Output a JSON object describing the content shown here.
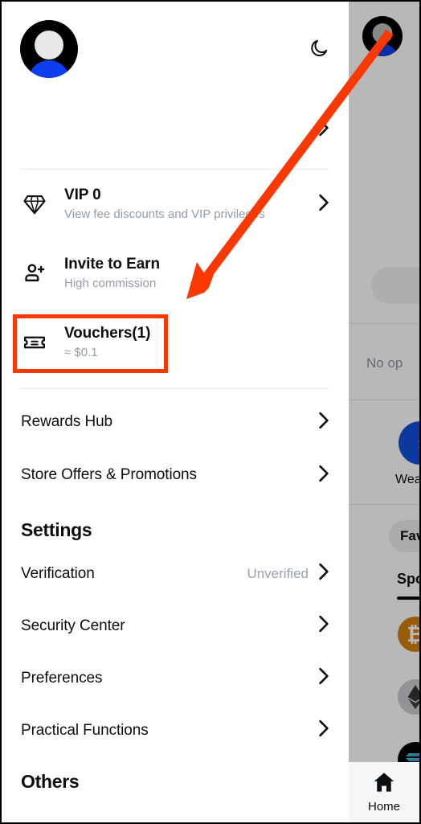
{
  "accent": {
    "highlight": "#f93802",
    "brand_blue": "#0d3ff0",
    "text": "#0b0e11",
    "muted": "#949ca8"
  },
  "drawer": {
    "header": {
      "avatar_icon": "user-avatar-icon",
      "theme_toggle_icon": "moon-icon"
    },
    "promo_row": {
      "chevron_icon": "chevron-right-icon"
    },
    "entries": [
      {
        "icon": "diamond-icon",
        "title": "VIP 0",
        "subtitle": "View fee discounts and VIP privileges",
        "chevron": "chevron-right-icon",
        "has_chevron": true
      },
      {
        "icon": "add-user-icon",
        "title": "Invite to Earn",
        "subtitle": "High commission",
        "chevron": "chevron-right-icon",
        "has_chevron": false
      },
      {
        "icon": "voucher-ticket-icon",
        "title": "Vouchers(1)",
        "subtitle": "≈ $0.1",
        "chevron": "chevron-right-icon",
        "has_chevron": false
      }
    ],
    "nav_rows": [
      {
        "label": "Rewards Hub",
        "value": "",
        "chevron": "chevron-right-icon"
      },
      {
        "label": "Store Offers & Promotions",
        "value": "",
        "chevron": "chevron-right-icon"
      }
    ],
    "settings": {
      "title": "Settings",
      "rows": [
        {
          "label": "Verification",
          "value": "Unverified",
          "chevron": "chevron-right-icon"
        },
        {
          "label": "Security Center",
          "value": "",
          "chevron": "chevron-right-icon"
        },
        {
          "label": "Preferences",
          "value": "",
          "chevron": "chevron-right-icon"
        },
        {
          "label": "Practical Functions",
          "value": "",
          "chevron": "chevron-right-icon"
        }
      ]
    },
    "others": {
      "title": "Others"
    }
  },
  "backdrop": {
    "avatar_icon": "user-avatar-icon",
    "no_orders_text": "No op",
    "wealth_label": "Wea",
    "wealth_icon": "wealth-arrow-icon",
    "favorites_label": "Favor",
    "spot_tab": "Spot",
    "coins": [
      {
        "name": "bitcoin-icon",
        "glyph": "₿"
      },
      {
        "name": "ethereum-icon",
        "glyph": "◆"
      },
      {
        "name": "solana-icon",
        "glyph": "≡"
      }
    ],
    "bottom_nav": {
      "label": "Home",
      "icon": "home-icon"
    }
  },
  "annotation": {
    "arrow_color": "#f93802",
    "highlight_target": "Vouchers(1)"
  }
}
